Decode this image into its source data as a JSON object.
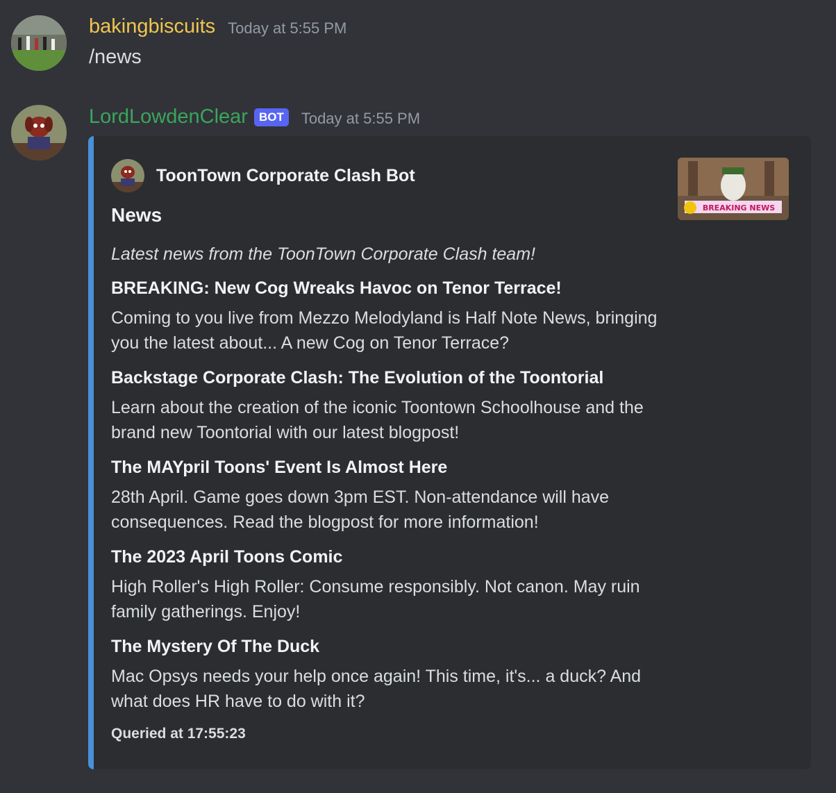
{
  "messages": [
    {
      "username": "bakingbiscuits",
      "username_color": "#f0c64f",
      "timestamp": "Today at 5:55 PM",
      "content": "/news"
    },
    {
      "username": "LordLowdenClear",
      "username_color": "#3ba55d",
      "bot_tag": "BOT",
      "timestamp": "Today at 5:55 PM"
    }
  ],
  "embed": {
    "accent_color": "#4a90d9",
    "author": "ToonTown Corporate Clash Bot",
    "title": "News",
    "description": "Latest news from the ToonTown Corporate Clash team!",
    "items": [
      {
        "title": "BREAKING: New Cog Wreaks Havoc on Tenor Terrace!",
        "text": "Coming to you live from Mezzo Melodyland is Half Note News, bringing you the latest about... A new Cog on Tenor Terrace?"
      },
      {
        "title": "Backstage Corporate Clash: The Evolution of the Toontorial",
        "text": "Learn about the creation of the iconic Toontown Schoolhouse and the brand new Toontorial with our latest blogpost!"
      },
      {
        "title": "The MAYpril Toons' Event Is Almost Here",
        "text": "28th April. Game goes down 3pm EST. Non-attendance will have consequences. Read the blogpost for more information!"
      },
      {
        "title": "The 2023 April Toons Comic",
        "text": "High Roller's High Roller: Consume responsibly. Not canon. May ruin family gatherings. Enjoy!"
      },
      {
        "title": "The Mystery Of The Duck",
        "text": "Mac Opsys needs your help once again! This time, it's... a duck? And what does HR have to do with it?"
      }
    ],
    "footer": "Queried at 17:55:23",
    "thumbnail": {
      "banner_text": "BREAKING NEWS"
    }
  }
}
